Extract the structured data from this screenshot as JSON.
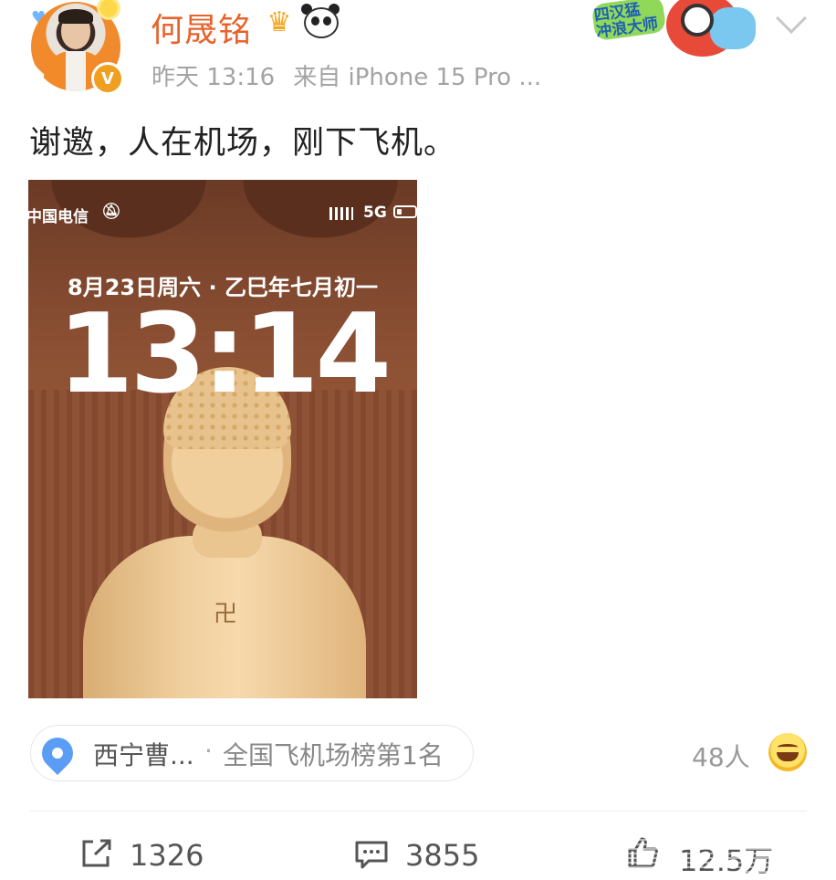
{
  "header": {
    "username": "何晟铭",
    "timestamp": "昨天 13:16",
    "source": "来自 iPhone 15 Pro ...",
    "badge_text_1": "四汉猛",
    "badge_text_2": "冲浪大师",
    "verify_mark": "V"
  },
  "post": {
    "text": "谢邀，人在机场，刚下飞机。"
  },
  "photo": {
    "carrier": "中国电信",
    "network": "5G",
    "date": "8月23日周六 · 乙巳年七月初一",
    "clock": "13:14"
  },
  "location": {
    "name": "西宁曹...",
    "separator": "·",
    "rank": "全国飞机场榜第1名",
    "visitors": "48人"
  },
  "actions": {
    "share_count": "1326",
    "comment_count": "3855",
    "like_count": "12.5万"
  },
  "colors": {
    "username": "#e8622c",
    "meta": "#a3a3a3",
    "pin": "#5b9df5",
    "verify": "#f0a020"
  },
  "icons": [
    "heart-icon",
    "sun-icon",
    "crown-icon",
    "panda-icon",
    "chevron-down-icon",
    "bell-icon",
    "signal-icon",
    "battery-icon",
    "pin-icon",
    "emoji-icon",
    "share-icon",
    "comment-icon",
    "like-icon"
  ]
}
